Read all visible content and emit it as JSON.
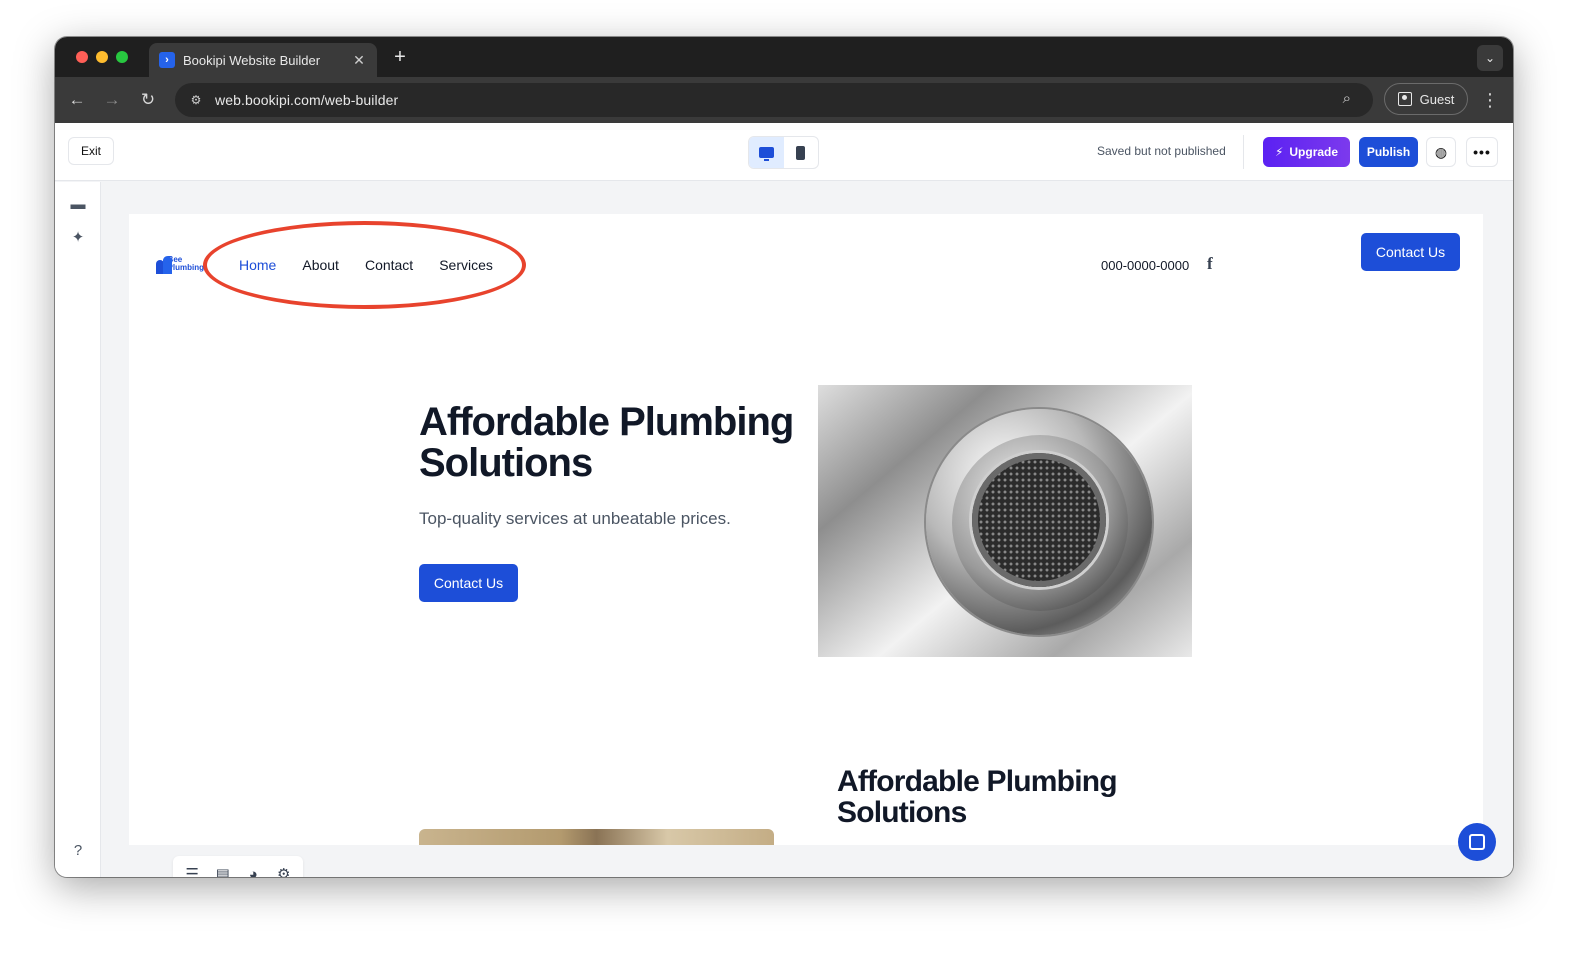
{
  "browser": {
    "tab_title": "Bookipi Website Builder",
    "url": "web.bookipi.com/web-builder",
    "profile_label": "Guest"
  },
  "app_header": {
    "exit_label": "Exit",
    "save_status": "Saved but not published",
    "upgrade_label": "Upgrade",
    "publish_label": "Publish"
  },
  "site": {
    "logo_text_line1": "Bee",
    "logo_text_line2": "Plumbing",
    "nav": [
      {
        "label": "Home",
        "active": true
      },
      {
        "label": "About",
        "active": false
      },
      {
        "label": "Contact",
        "active": false
      },
      {
        "label": "Services",
        "active": false
      }
    ],
    "phone": "000-0000-0000",
    "header_cta": "Contact Us",
    "hero": {
      "title": "Affordable Plumbing Solutions",
      "subtitle": "Top-quality services at unbeatable prices.",
      "cta": "Contact Us"
    },
    "section2": {
      "title": "Affordable Plumbing Solutions"
    }
  },
  "colors": {
    "accent": "#1d4ed8",
    "upgrade": "#6d28d9",
    "annotation": "#e8432d"
  },
  "icons": {
    "left_rail": [
      "comment-icon",
      "magic-wand-icon",
      "help-icon"
    ],
    "bottom_toolbar": [
      "list-icon",
      "layers-icon",
      "palette-icon",
      "gear-icon"
    ]
  }
}
